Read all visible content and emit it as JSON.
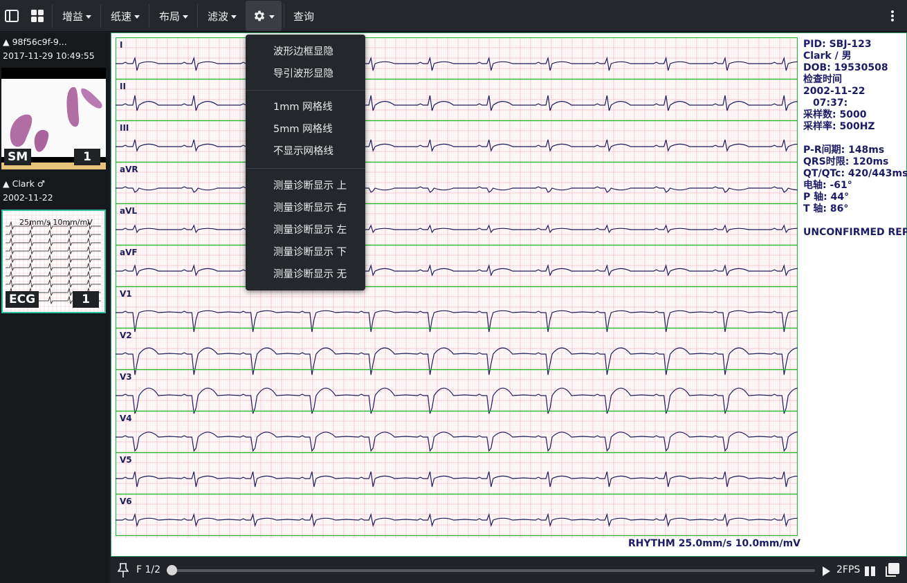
{
  "toolbar": {
    "gain_label": "增益",
    "speed_label": "纸速",
    "layout_label": "布局",
    "filter_label": "滤波",
    "query_label": "查询"
  },
  "sidebar": {
    "studies": [
      {
        "header": "▲ 98f56c9f-9...",
        "datetime": "2017-11-29 10:49:55",
        "modality": "SM",
        "count": "1"
      },
      {
        "header": "▲ Clark ♂",
        "datetime": "2002-11-22",
        "modality": "ECG",
        "count": "1",
        "thumb_caption": "25mm/s 10mm/mV"
      }
    ]
  },
  "ecg": {
    "leads": [
      "I",
      "II",
      "III",
      "aVR",
      "aVL",
      "aVF",
      "V1",
      "V2",
      "V3",
      "V4",
      "V5",
      "V6"
    ],
    "rhythm_label": "RHYTHM 25.0mm/s 10.0mm/mV",
    "grid_color": "#f4b9c3",
    "lead_separator_color": "#22bb33",
    "trace_color": "#1c1c5a"
  },
  "info": {
    "pid": "PID: SBJ-123",
    "name_sex": "Clark / 男",
    "dob": "DOB: 19530508",
    "exam_time_label": "检查时间",
    "exam_date": "2002-11-22",
    "exam_time": "07:37:",
    "samples": "采样数: 5000",
    "sample_rate": "采样率: 500HZ",
    "pr": "P-R间期: 148ms",
    "qrs": "QRS时限: 120ms",
    "qt": "QT/QTc: 420/443ms",
    "axis": "电轴: -61°",
    "p_axis": "P 轴: 44°",
    "t_axis": "T 轴: 86°",
    "status": "UNCONFIRMED REPORT"
  },
  "bottombar": {
    "frame": "F 1/2",
    "fps": "2FPS",
    "progress": 0
  },
  "dropdown": {
    "items": [
      "波形边框显隐",
      "导引波形显隐",
      "1mm 网格线",
      "5mm 网格线",
      "不显示网格线",
      "测量诊断显示 上",
      "测量诊断显示 右",
      "测量诊断显示 左",
      "测量诊断显示 下",
      "测量诊断显示 无"
    ]
  }
}
